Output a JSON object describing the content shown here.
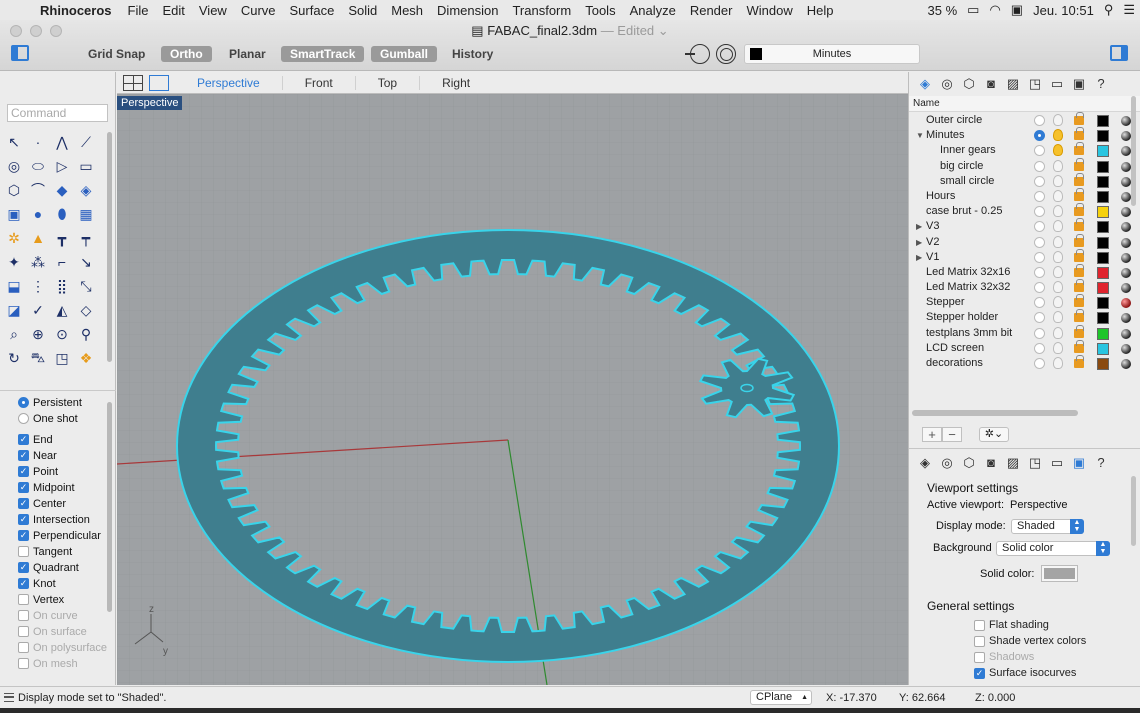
{
  "menubar": {
    "app_name": "Rhinoceros",
    "menus": [
      "File",
      "Edit",
      "View",
      "Curve",
      "Surface",
      "Solid",
      "Mesh",
      "Dimension",
      "Transform",
      "Tools",
      "Analyze",
      "Render",
      "Window",
      "Help"
    ],
    "battery": "35 %",
    "clock": "Jeu. 10:51"
  },
  "window": {
    "doc_name": "FABAC_final2.3dm",
    "doc_status": "— Edited",
    "modes": {
      "grid_snap": "Grid Snap",
      "ortho": "Ortho",
      "planar": "Planar",
      "smarttrack": "SmartTrack",
      "gumball": "Gumball",
      "history": "History"
    },
    "current_layer": "Minutes"
  },
  "command": {
    "placeholder": "Command"
  },
  "osnaps": {
    "persistent": "Persistent",
    "one_shot": "One shot",
    "items": [
      "End",
      "Near",
      "Point",
      "Midpoint",
      "Center",
      "Intersection",
      "Perpendicular",
      "Tangent",
      "Quadrant",
      "Knot",
      "Vertex",
      "On curve",
      "On surface",
      "On polysurface",
      "On mesh"
    ]
  },
  "viewport": {
    "tabs": [
      "Perspective",
      "Front",
      "Top",
      "Right"
    ],
    "label": "Perspective",
    "axis_z": "z",
    "axis_y": "y",
    "colors": {
      "background": "#9ea1a4",
      "object": "#3f7e8e",
      "highlight": "#39d4ea"
    }
  },
  "layers": {
    "header": "Name",
    "rows": [
      {
        "name": "Outer circle",
        "color": "#000000"
      },
      {
        "name": "Minutes",
        "color": "#000000",
        "current": true
      },
      {
        "name": "Inner gears",
        "color": "#29c5e0"
      },
      {
        "name": "big circle",
        "color": "#000000"
      },
      {
        "name": "small circle",
        "color": "#000000"
      },
      {
        "name": "Hours",
        "color": "#000000"
      },
      {
        "name": "case brut - 0.25",
        "color": "#f6d10c"
      },
      {
        "name": "V3",
        "color": "#000000"
      },
      {
        "name": "V2",
        "color": "#000000"
      },
      {
        "name": "V1",
        "color": "#000000"
      },
      {
        "name": "Led Matrix 32x16",
        "color": "#e0242e"
      },
      {
        "name": "Led Matrix 32x32",
        "color": "#e0242e"
      },
      {
        "name": "Stepper",
        "color": "#000000"
      },
      {
        "name": "Stepper holder",
        "color": "#000000"
      },
      {
        "name": "testplans 3mm bit",
        "color": "#1fc52a"
      },
      {
        "name": "LCD screen",
        "color": "#29c5e0"
      },
      {
        "name": "decorations",
        "color": "#8a4a10"
      }
    ]
  },
  "viewport_settings": {
    "title": "Viewport settings",
    "active_viewport_label": "Active viewport:",
    "active_viewport": "Perspective",
    "display_mode_label": "Display mode:",
    "display_mode": "Shaded",
    "background_label": "Background",
    "background": "Solid color",
    "solid_color_label": "Solid color:",
    "general_title": "General settings",
    "flat_shading": "Flat shading",
    "shade_vertex_colors": "Shade vertex colors",
    "shadows": "Shadows",
    "surface_isocurves": "Surface isocurves"
  },
  "status": {
    "message": "Display mode set to \"Shaded\".",
    "cplane": "CPlane",
    "x": "X: -17.370",
    "y": "Y: 62.664",
    "z": "Z: 0.000"
  }
}
